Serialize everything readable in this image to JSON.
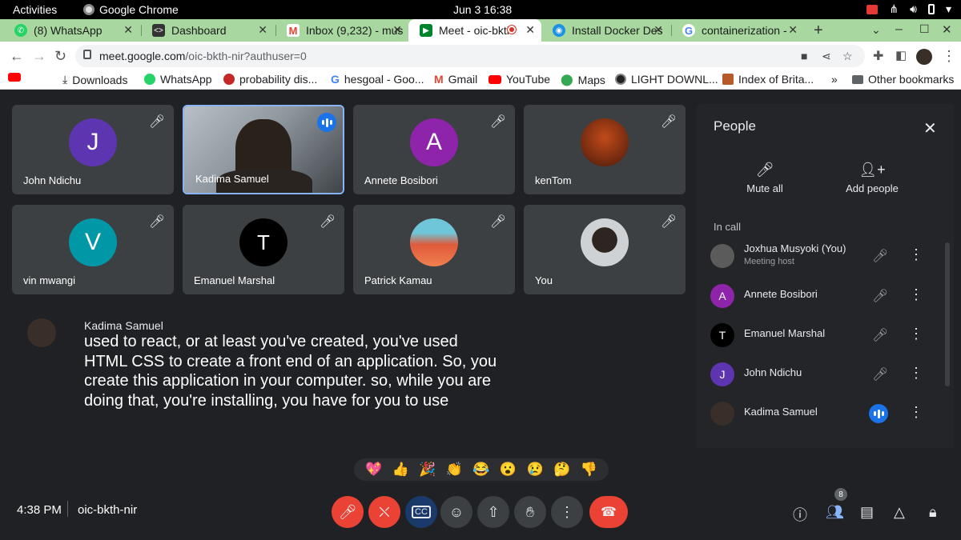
{
  "os_bar": {
    "activities": "Activities",
    "app": "Google Chrome",
    "clock": "Jun 3  16:38"
  },
  "tabs": [
    {
      "title": "(8) WhatsApp",
      "favicon": "whatsapp-icon",
      "color": "#25d366"
    },
    {
      "title": "Dashboard",
      "favicon": "dashboard-icon",
      "color": "#333333"
    },
    {
      "title": "Inbox (9,232) - mus",
      "favicon": "gmail-icon",
      "color": "#ea4335"
    },
    {
      "title": "Meet - oic-bkth",
      "favicon": "meet-icon",
      "color": "#00832d"
    },
    {
      "title": "Install Docker Des",
      "favicon": "docker-icon",
      "color": "#1d91e6"
    },
    {
      "title": "containerization -",
      "favicon": "google-icon",
      "color": "#4285f4"
    }
  ],
  "omnibox": {
    "host": "meet.google.com",
    "path": "/oic-bkth-nir?authuser=0"
  },
  "bookmarks": [
    {
      "label": "Downloads",
      "icon": "download-icon"
    },
    {
      "label": "WhatsApp",
      "icon": "whatsapp-icon"
    },
    {
      "label": "probability dis...",
      "icon": "flower-icon"
    },
    {
      "label": "hesgoal - Goo...",
      "icon": "google-icon"
    },
    {
      "label": "Gmail",
      "icon": "gmail-icon"
    },
    {
      "label": "YouTube",
      "icon": "youtube-icon"
    },
    {
      "label": "Maps",
      "icon": "maps-icon"
    },
    {
      "label": "LIGHT DOWNL...",
      "icon": "site-icon"
    },
    {
      "label": "Index of Brita...",
      "icon": "site-icon"
    }
  ],
  "other_bookmarks": "Other bookmarks",
  "more_bookmarks": "»",
  "tiles": [
    {
      "name": "John Ndichu",
      "initial": "J",
      "color": "#5e35b1"
    },
    {
      "name": "Kadima Samuel",
      "initial": "",
      "color": "#777777"
    },
    {
      "name": "Annete Bosibori",
      "initial": "A",
      "color": "#8e24aa"
    },
    {
      "name": "kenTom",
      "initial": "",
      "color": "#7a2d12"
    },
    {
      "name": "vin mwangi",
      "initial": "V",
      "color": "#0097a7"
    },
    {
      "name": "Emanuel Marshal",
      "initial": "",
      "color": "#000000"
    },
    {
      "name": "Patrick Kamau",
      "initial": "",
      "color": "#e64a19"
    },
    {
      "name": "You",
      "initial": "",
      "color": "#5b5b5b"
    }
  ],
  "caption": {
    "speaker": "Kadima Samuel",
    "text": "used to react, or at least you've created, you've used HTML CSS to create a front end of an application. So, you create this application in your computer. so, while you are doing that, you're installing, you have for you to use"
  },
  "reactions": [
    "💖",
    "👍",
    "🎉",
    "👏",
    "😂",
    "😮",
    "😢",
    "🤔",
    "👎"
  ],
  "bottom": {
    "time": "4:38 PM",
    "code": "oic-bkth-nir",
    "people_count": "8"
  },
  "panel": {
    "title": "People",
    "mute_all": "Mute all",
    "add_people": "Add people",
    "in_call": "In call",
    "participants": [
      {
        "name": "Joxhua Musyoki (You)",
        "role": "Meeting host",
        "initial": "",
        "color": "#5b5b5b",
        "state": "muted"
      },
      {
        "name": "Annete Bosibori",
        "role": "",
        "initial": "A",
        "color": "#8e24aa",
        "state": "muted"
      },
      {
        "name": "Emanuel Marshal",
        "role": "",
        "initial": "",
        "color": "#000000",
        "state": "muted"
      },
      {
        "name": "John Ndichu",
        "role": "",
        "initial": "J",
        "color": "#5e35b1",
        "state": "muted"
      },
      {
        "name": "Kadima Samuel",
        "role": "",
        "initial": "",
        "color": "#3a2f28",
        "state": "speaking"
      }
    ]
  }
}
